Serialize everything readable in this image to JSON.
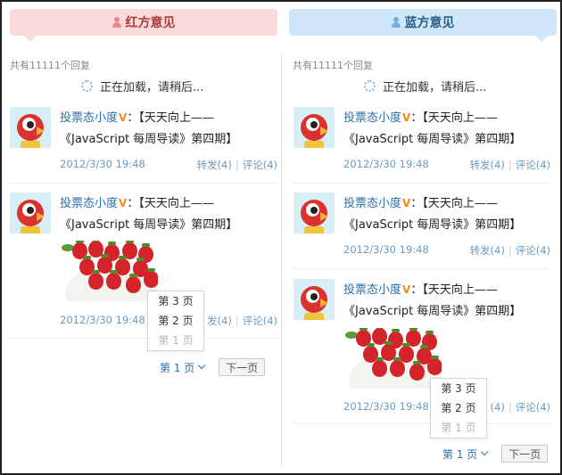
{
  "red": {
    "title": "红方意见",
    "total_text": "共有11111个回复",
    "loading_text": "正在加载，请稍后...",
    "posts": [
      {
        "author": "投票态小度",
        "text_line1": "：【天天向上——",
        "text_line2": "《JavaScript 每周导读》第四期】",
        "time": "2012/3/30 19:48",
        "repost": "转发(4)",
        "comment": "评论(4)",
        "has_photo": false
      },
      {
        "author": "投票态小度",
        "text_line1": "：【天天向上——",
        "text_line2": "《JavaScript 每周导读》第四期】",
        "time": "2012/3/30 19:48",
        "repost": "发(4)",
        "comment": "评论(4)",
        "has_photo": true
      }
    ],
    "pager": {
      "current": "第 1 页",
      "next": "下一页",
      "options": [
        "第 3 页",
        "第 2 页",
        "第 1 页"
      ]
    }
  },
  "blue": {
    "title": "蓝方意见",
    "total_text": "共有11111个回复",
    "loading_text": "正在加载，请稍后...",
    "posts": [
      {
        "author": "投票态小度",
        "text_line1": "：【天天向上——",
        "text_line2": "《JavaScript 每周导读》第四期】",
        "time": "2012/3/30 19:48",
        "repost": "转发(4)",
        "comment": "评论(4)",
        "has_photo": false
      },
      {
        "author": "投票态小度",
        "text_line1": "：【天天向上——",
        "text_line2": "《JavaScript 每周导读》第四期】",
        "time": "2012/3/30 19:48",
        "repost": "转发(4)",
        "comment": "评论(4)",
        "has_photo": false
      },
      {
        "author": "投票态小度",
        "text_line1": "：【天天向上——",
        "text_line2": "《JavaScript 每周导读》第四期】",
        "time": "2012/3/30 19:48",
        "repost": "(4)",
        "comment": "评论(4)",
        "has_photo": true
      }
    ],
    "pager": {
      "current": "第 1 页",
      "next": "下一页",
      "options": [
        "第 3 页",
        "第 2 页",
        "第 1 页"
      ]
    }
  },
  "icons": {
    "header": "user-icon",
    "loading": "spinner-icon",
    "verified": "verified-v-icon",
    "avatar": "bird-avatar-icon",
    "dropdown": "chevron-down-icon"
  },
  "colors": {
    "red_header_bg": "#fadbdb",
    "blue_header_bg": "#cfe7f8",
    "link": "#2b6fa8",
    "meta": "#6b9ac0",
    "verified": "#f08a1c"
  }
}
